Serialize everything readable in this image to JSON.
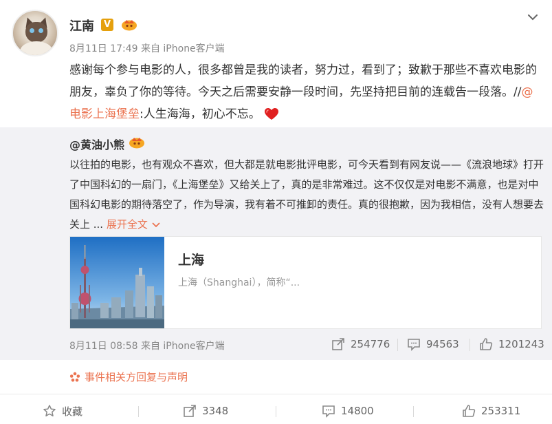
{
  "post": {
    "author": "江南",
    "meta": "8月11日 17:49 来自 iPhone客户端",
    "text_before": "感谢每个参与电影的人，很多都曾是我的读者，努力过，看到了；致歉于那些不喜欢电影的朋友，辜负了你的等待。今天之后需要安静一段时间，先坚持把目前的连载告一段落。//",
    "link": "@电影上海堡垒",
    "text_after": ":人生海海，初心不忘。"
  },
  "repost": {
    "author": "@黄油小熊",
    "text": "以往拍的电影，也有观众不喜欢，但大都是就电影批评电影，可今天看到有网友说——《流浪地球》打开了中国科幻的一扇门，《上海堡垒》又给关上了，真的是非常难过。这不仅仅是对电影不满意，也是对中国科幻电影的期待落空了，作为导演，我有着不可推卸的责任。真的很抱歉，因为我相信，没有人想要去关上 ...",
    "expand": "展开全文",
    "card": {
      "title": "上海",
      "desc": "上海（Shanghai），简称“..."
    },
    "meta": "8月11日 08:58 来自 iPhone客户端",
    "reposts": "254776",
    "comments": "94563",
    "likes": "1201243"
  },
  "event_link": "事件相关方回复与声明",
  "actions": {
    "favorite": "收藏",
    "reposts": "3348",
    "comments": "14800",
    "likes": "253311"
  },
  "colors": {
    "accent": "#eb7350",
    "repost_bg": "#f2f2f5",
    "verified": "#e5a00d",
    "heart": "#e02020"
  },
  "icons": {
    "verified": "verified-v-icon",
    "member": "member-crown-icon",
    "dropdown": "chevron-down-icon",
    "heart": "heart-icon",
    "repost": "repost-icon",
    "comment": "comment-icon",
    "like": "thumbs-up-icon",
    "favorite": "star-icon",
    "event": "flower-icon"
  }
}
